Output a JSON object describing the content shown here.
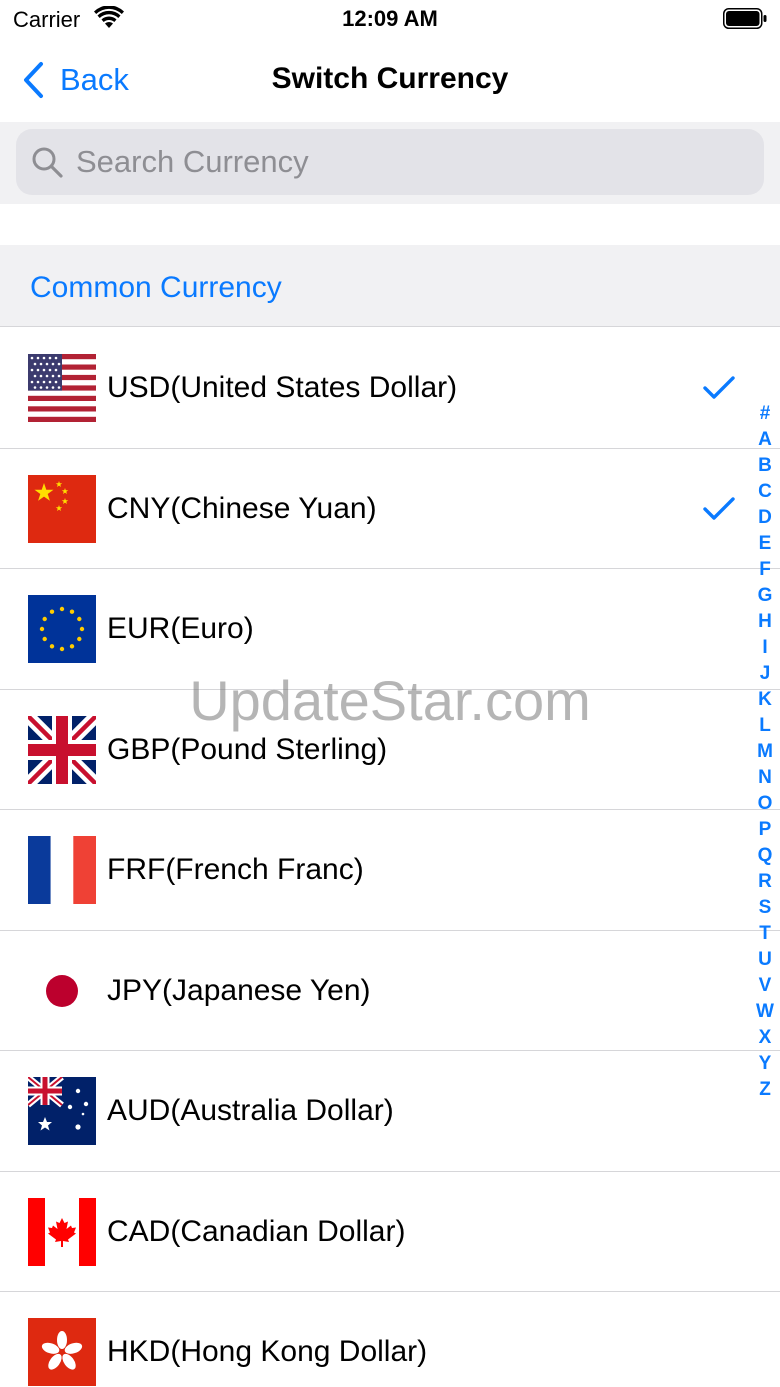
{
  "status_bar": {
    "carrier": "Carrier",
    "time": "12:09 AM"
  },
  "nav": {
    "back_label": "Back",
    "title": "Switch Currency"
  },
  "search": {
    "placeholder": "Search Currency",
    "value": ""
  },
  "section": {
    "title": "Common Currency"
  },
  "currencies": [
    {
      "label": "USD(United States Dollar)",
      "flag": "us-flag-icon",
      "checked": true
    },
    {
      "label": "CNY(Chinese Yuan)",
      "flag": "cn-flag-icon",
      "checked": true
    },
    {
      "label": "EUR(Euro)",
      "flag": "eu-flag-icon",
      "checked": false
    },
    {
      "label": "GBP(Pound Sterling)",
      "flag": "uk-flag-icon",
      "checked": false
    },
    {
      "label": "FRF(French Franc)",
      "flag": "fr-flag-icon",
      "checked": false
    },
    {
      "label": "JPY(Japanese Yen)",
      "flag": "jp-flag-icon",
      "checked": false
    },
    {
      "label": "AUD(Australia Dollar)",
      "flag": "au-flag-icon",
      "checked": false
    },
    {
      "label": "CAD(Canadian Dollar)",
      "flag": "ca-flag-icon",
      "checked": false
    },
    {
      "label": "HKD(Hong Kong Dollar)",
      "flag": "hk-flag-icon",
      "checked": false
    }
  ],
  "index_letters": [
    "#",
    "A",
    "B",
    "C",
    "D",
    "E",
    "F",
    "G",
    "H",
    "I",
    "J",
    "K",
    "L",
    "M",
    "N",
    "O",
    "P",
    "Q",
    "R",
    "S",
    "T",
    "U",
    "V",
    "W",
    "X",
    "Y",
    "Z"
  ],
  "watermark": "UpdateStar.com",
  "colors": {
    "accent": "#0a7aff",
    "section_bg": "#f1f1f3",
    "search_bg": "#e3e3e8",
    "separator": "#d6d6d9"
  }
}
